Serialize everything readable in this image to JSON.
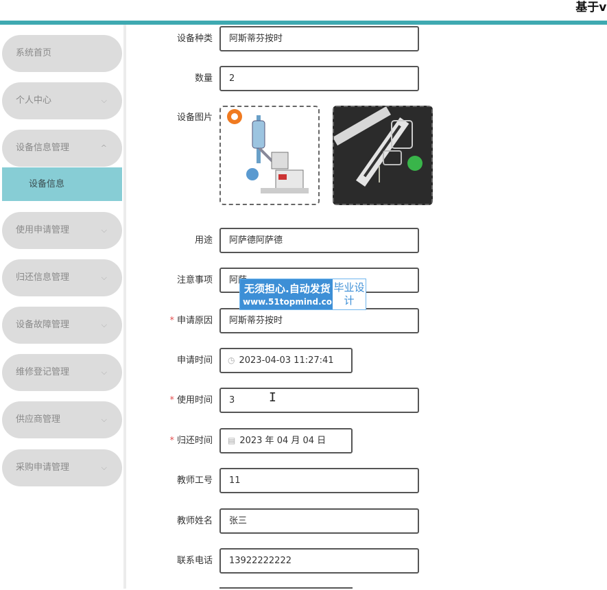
{
  "header": {
    "title": "基于vue的"
  },
  "sidebar": {
    "items": [
      {
        "label": "系统首页"
      },
      {
        "label": "个人中心"
      },
      {
        "label": "设备信息管理"
      },
      {
        "label": "使用申请管理"
      },
      {
        "label": "归还信息管理"
      },
      {
        "label": "设备故障管理"
      },
      {
        "label": "维修登记管理"
      },
      {
        "label": "供应商管理"
      },
      {
        "label": "采购申请管理"
      }
    ],
    "sub_item": {
      "label": "设备信息"
    },
    "chevron_down": "⌵",
    "chevron_up": "^"
  },
  "form": {
    "device_type": {
      "label": "设备种类",
      "value": "阿斯蒂芬按时"
    },
    "quantity": {
      "label": "数量",
      "value": "2"
    },
    "device_image": {
      "label": "设备图片"
    },
    "purpose": {
      "label": "用途",
      "value": "阿萨德阿萨德"
    },
    "notes": {
      "label": "注意事项",
      "value": "阿萨"
    },
    "reason": {
      "label": "申请原因",
      "value": "阿斯蒂芬按时"
    },
    "apply_time": {
      "label": "申请时间",
      "value": "2023-04-03 11:27:41"
    },
    "use_time": {
      "label": "使用时间",
      "value": "3"
    },
    "return_time": {
      "label": "归还时间",
      "value": "2023 年 04 月 04 日"
    },
    "teacher_id": {
      "label": "教师工号",
      "value": "11"
    },
    "teacher_name": {
      "label": "教师姓名",
      "value": "张三"
    },
    "phone": {
      "label": "联系电话",
      "value": "13922222222"
    },
    "required_mark": "*"
  },
  "watermark": {
    "line1": "无须担心.自动发货",
    "line2": "www.51topmind.com",
    "badge": "毕业设计"
  },
  "icons": {
    "clock": "clock-icon",
    "calendar": "calendar-icon"
  }
}
